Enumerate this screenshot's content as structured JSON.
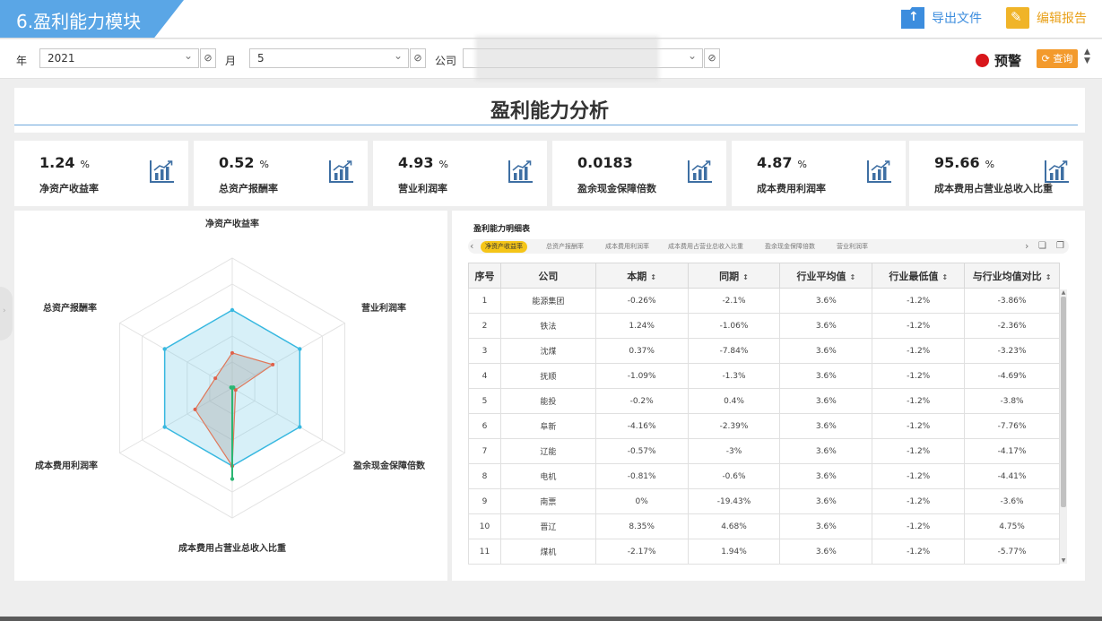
{
  "header": {
    "title": "6.盈利能力模块",
    "export_label": "导出文件",
    "edit_label": "编辑报告"
  },
  "filters": {
    "year_label": "年",
    "year_value": "2021",
    "month_label": "月",
    "month_value": "5",
    "company_label": "公司",
    "company_value": "",
    "warning_label": "预警",
    "query_label": "查询"
  },
  "page_title": "盈利能力分析",
  "kpis": [
    {
      "value": "1.24",
      "unit": "%",
      "label": "净资产收益率"
    },
    {
      "value": "0.52",
      "unit": "%",
      "label": "总资产报酬率"
    },
    {
      "value": "4.93",
      "unit": "%",
      "label": "营业利润率"
    },
    {
      "value": "0.0183",
      "unit": "",
      "label": "盈余现金保障倍数"
    },
    {
      "value": "4.87",
      "unit": "%",
      "label": "成本费用利润率"
    },
    {
      "value": "95.66",
      "unit": "%",
      "label": "成本费用占营业总收入比重"
    }
  ],
  "radar": {
    "axes": [
      "净资产收益率",
      "营业利润率",
      "盈余现金保障倍数",
      "成本费用占营业总收入比重",
      "成本费用利润率",
      "总资产报酬率"
    ]
  },
  "table": {
    "title": "盈利能力明细表",
    "tabs": [
      "净资产收益率",
      "总资产报酬率",
      "成本费用利润率",
      "成本费用占营业总收入比重",
      "盈余现金保障倍数",
      "营业利润率"
    ],
    "active_tab": 0,
    "columns": [
      "序号",
      "公司",
      "本期",
      "同期",
      "行业平均值",
      "行业最低值",
      "与行业均值对比"
    ],
    "rows": [
      [
        "1",
        "能源集团",
        "-0.26%",
        "-2.1%",
        "3.6%",
        "-1.2%",
        "-3.86%"
      ],
      [
        "2",
        "铁法",
        "1.24%",
        "-1.06%",
        "3.6%",
        "-1.2%",
        "-2.36%"
      ],
      [
        "3",
        "沈煤",
        "0.37%",
        "-7.84%",
        "3.6%",
        "-1.2%",
        "-3.23%"
      ],
      [
        "4",
        "抚顺",
        "-1.09%",
        "-1.3%",
        "3.6%",
        "-1.2%",
        "-4.69%"
      ],
      [
        "5",
        "能投",
        "-0.2%",
        "0.4%",
        "3.6%",
        "-1.2%",
        "-3.8%"
      ],
      [
        "6",
        "阜新",
        "-4.16%",
        "-2.39%",
        "3.6%",
        "-1.2%",
        "-7.76%"
      ],
      [
        "7",
        "辽能",
        "-0.57%",
        "-3%",
        "3.6%",
        "-1.2%",
        "-4.17%"
      ],
      [
        "8",
        "电机",
        "-0.81%",
        "-0.6%",
        "3.6%",
        "-1.2%",
        "-4.41%"
      ],
      [
        "9",
        "南票",
        "0%",
        "-19.43%",
        "3.6%",
        "-1.2%",
        "-3.6%"
      ],
      [
        "10",
        "晋辽",
        "8.35%",
        "4.68%",
        "3.6%",
        "-1.2%",
        "4.75%"
      ],
      [
        "11",
        "煤机",
        "-2.17%",
        "1.94%",
        "3.6%",
        "-1.2%",
        "-5.77%"
      ]
    ]
  },
  "colors": {
    "accent": "#5aa6e6",
    "warning": "#d8161b",
    "query": "#f39a2c",
    "tab_active": "#f5c518"
  }
}
